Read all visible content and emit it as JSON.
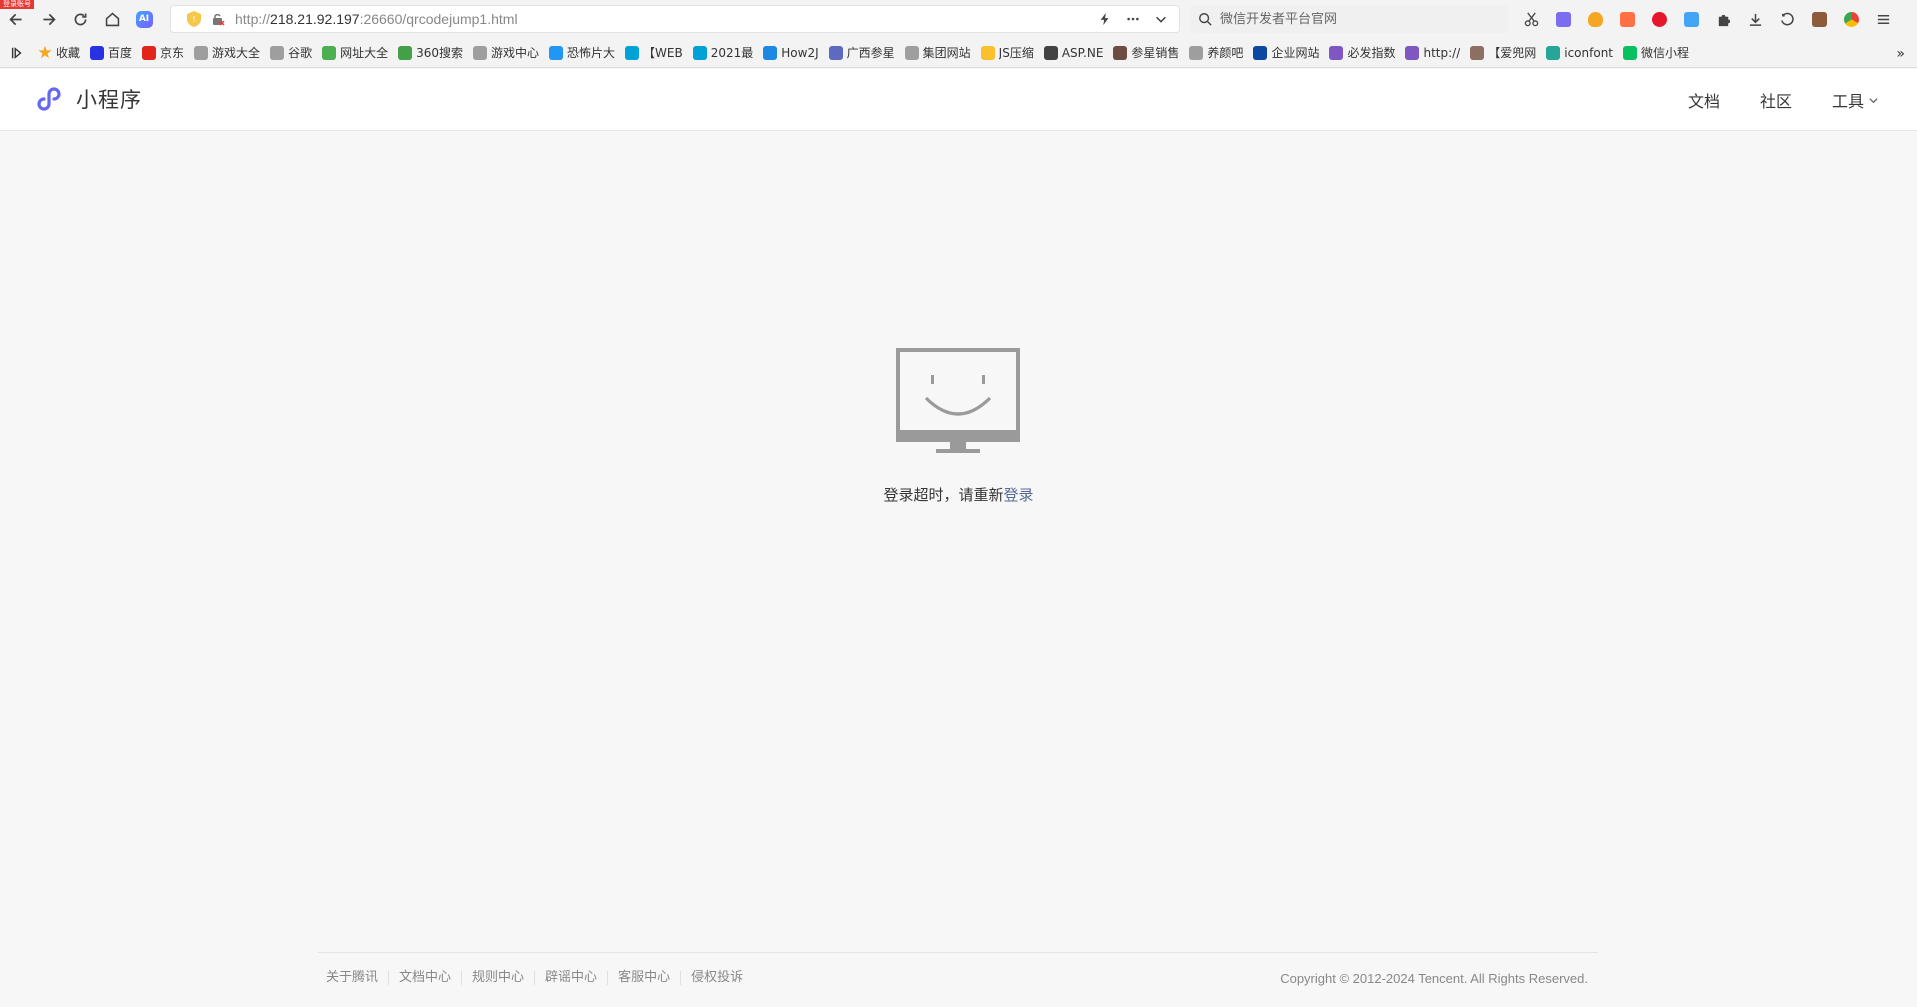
{
  "browser": {
    "corner_badge": "登录账号",
    "url_prefix": "http://",
    "url_host": "218.21.92.197",
    "url_rest": ":26660/qrcodejump1.html",
    "search_placeholder": "微信开发者平台官网",
    "ai_label": "AI",
    "bookmarks": [
      {
        "label": "收藏",
        "color": "#f5a623"
      },
      {
        "label": "百度",
        "color": "#2932e1"
      },
      {
        "label": "京东",
        "color": "#e1251b"
      },
      {
        "label": "游戏大全",
        "color": "#9e9e9e"
      },
      {
        "label": "谷歌",
        "color": "#9e9e9e"
      },
      {
        "label": "网址大全",
        "color": "#4caf50"
      },
      {
        "label": "360搜索",
        "color": "#43a047"
      },
      {
        "label": "游戏中心",
        "color": "#9e9e9e"
      },
      {
        "label": "恐怖片大",
        "color": "#2196f3"
      },
      {
        "label": "【WEB",
        "color": "#00a1d6"
      },
      {
        "label": "2021最",
        "color": "#00a1d6"
      },
      {
        "label": "How2J",
        "color": "#1e88e5"
      },
      {
        "label": "广西参星",
        "color": "#5c6bc0"
      },
      {
        "label": "集团网站",
        "color": "#9e9e9e"
      },
      {
        "label": "JS压缩",
        "color": "#fbc02d"
      },
      {
        "label": "ASP.NE",
        "color": "#424242"
      },
      {
        "label": "参星销售",
        "color": "#6d4c41"
      },
      {
        "label": "养颜吧",
        "color": "#9e9e9e"
      },
      {
        "label": "企业网站",
        "color": "#0d47a1"
      },
      {
        "label": "必发指数",
        "color": "#7e57c2"
      },
      {
        "label": "http://",
        "color": "#7e57c2"
      },
      {
        "label": "【爱兜网",
        "color": "#8d6e63"
      },
      {
        "label": "iconfont",
        "color": "#26a69a"
      },
      {
        "label": "微信小程",
        "color": "#07c160"
      }
    ]
  },
  "header": {
    "logo_text": "小程序",
    "nav": {
      "docs": "文档",
      "community": "社区",
      "tools": "工具"
    }
  },
  "main": {
    "message_prefix": "登录超时，请重新",
    "login_link": "登录"
  },
  "footer": {
    "links": [
      "关于腾讯",
      "文档中心",
      "规则中心",
      "辟谣中心",
      "客服中心",
      "侵权投诉"
    ],
    "copyright": "Copyright © 2012-2024 Tencent. All Rights Reserved."
  },
  "colors": {
    "link": "#576b95",
    "logo_purple": "#6467f0",
    "monitor_gray": "#9a9a9a"
  }
}
